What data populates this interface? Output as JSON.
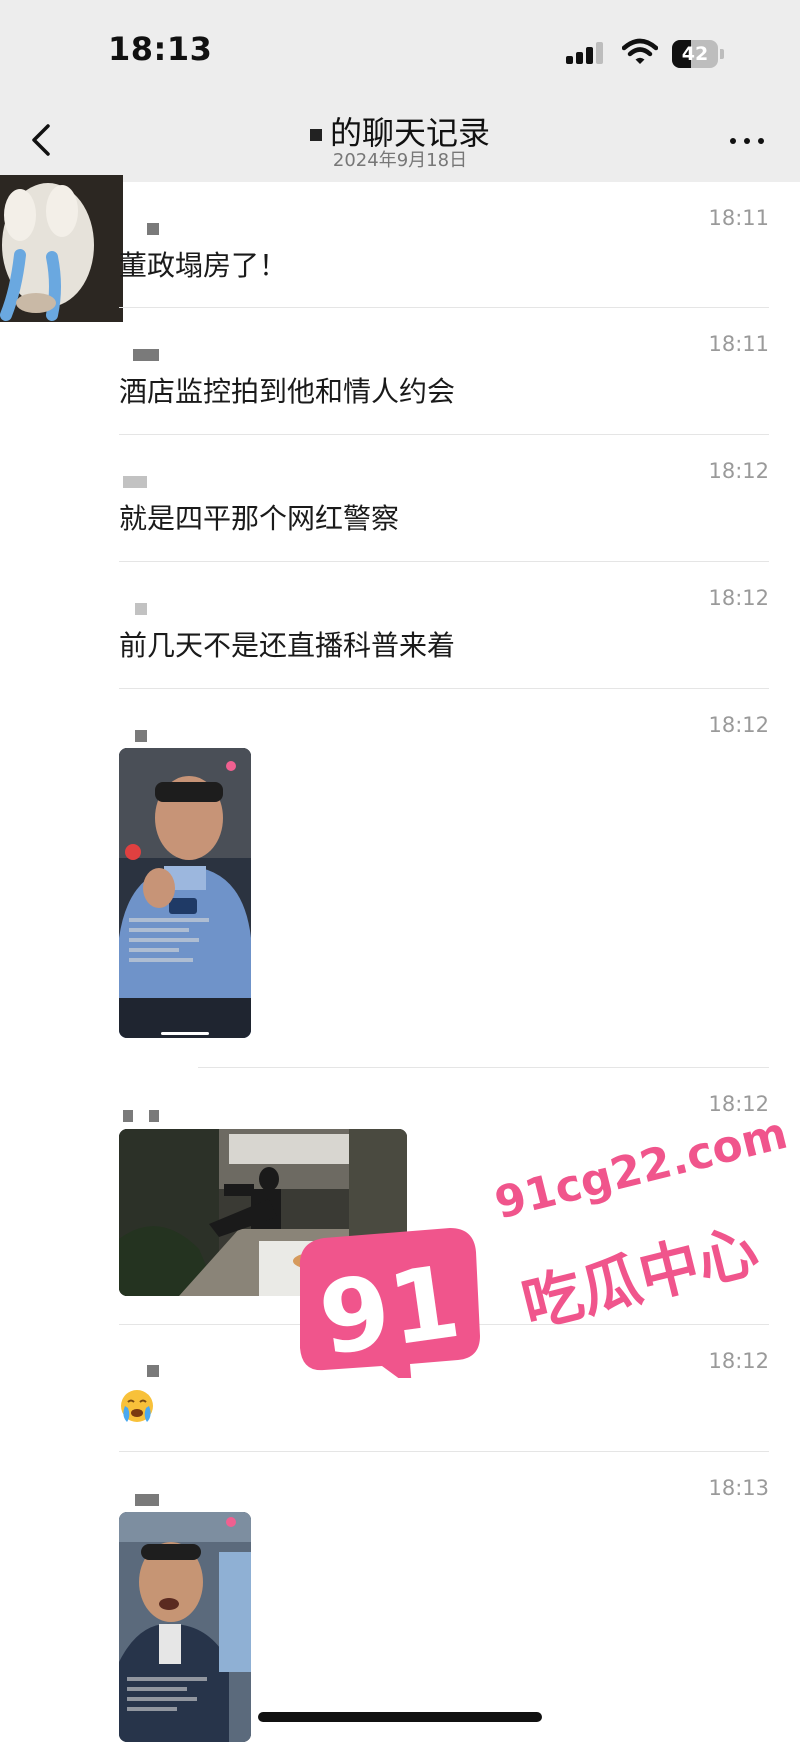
{
  "status_bar": {
    "time": "18:13",
    "battery_level": "42",
    "battery_fraction": 0.42,
    "icons": [
      "signal-icon",
      "wifi-icon",
      "battery-icon"
    ]
  },
  "nav": {
    "title": "的聊天记录",
    "date": "2024年9月18日",
    "icons": [
      "back-icon",
      "more-icon"
    ]
  },
  "messages": [
    {
      "time": "18:11",
      "type": "text",
      "text": "董政塌房了！"
    },
    {
      "time": "18:11",
      "type": "text",
      "text": "酒店监控拍到他和情人约会"
    },
    {
      "time": "18:12",
      "type": "text",
      "text": "就是四平那个网红警察"
    },
    {
      "time": "18:12",
      "type": "text",
      "text": "前几天不是还直播科普来着"
    },
    {
      "time": "18:12",
      "type": "video",
      "media": "police-livestream-thumbnail"
    },
    {
      "time": "18:12",
      "type": "video",
      "media": "hotel-cctv-thumbnail"
    },
    {
      "time": "18:12",
      "type": "emoji",
      "media": "crying-face-emoji"
    },
    {
      "time": "18:13",
      "type": "video",
      "media": "livestream-thumbnail"
    }
  ],
  "watermark": {
    "number": "91",
    "domain": "91cg22.com",
    "brand": "吃瓜中心",
    "color": "#f0558c"
  }
}
